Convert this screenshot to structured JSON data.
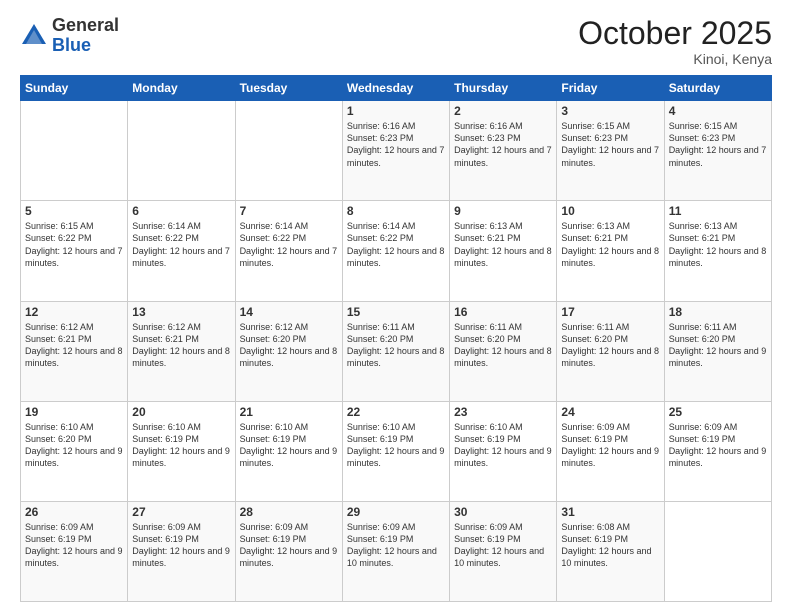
{
  "header": {
    "logo_general": "General",
    "logo_blue": "Blue",
    "month_title": "October 2025",
    "location": "Kinoi, Kenya"
  },
  "days_of_week": [
    "Sunday",
    "Monday",
    "Tuesday",
    "Wednesday",
    "Thursday",
    "Friday",
    "Saturday"
  ],
  "weeks": [
    [
      {
        "day": "",
        "sunrise": "",
        "sunset": "",
        "daylight": ""
      },
      {
        "day": "",
        "sunrise": "",
        "sunset": "",
        "daylight": ""
      },
      {
        "day": "",
        "sunrise": "",
        "sunset": "",
        "daylight": ""
      },
      {
        "day": "1",
        "sunrise": "Sunrise: 6:16 AM",
        "sunset": "Sunset: 6:23 PM",
        "daylight": "Daylight: 12 hours and 7 minutes."
      },
      {
        "day": "2",
        "sunrise": "Sunrise: 6:16 AM",
        "sunset": "Sunset: 6:23 PM",
        "daylight": "Daylight: 12 hours and 7 minutes."
      },
      {
        "day": "3",
        "sunrise": "Sunrise: 6:15 AM",
        "sunset": "Sunset: 6:23 PM",
        "daylight": "Daylight: 12 hours and 7 minutes."
      },
      {
        "day": "4",
        "sunrise": "Sunrise: 6:15 AM",
        "sunset": "Sunset: 6:23 PM",
        "daylight": "Daylight: 12 hours and 7 minutes."
      }
    ],
    [
      {
        "day": "5",
        "sunrise": "Sunrise: 6:15 AM",
        "sunset": "Sunset: 6:22 PM",
        "daylight": "Daylight: 12 hours and 7 minutes."
      },
      {
        "day": "6",
        "sunrise": "Sunrise: 6:14 AM",
        "sunset": "Sunset: 6:22 PM",
        "daylight": "Daylight: 12 hours and 7 minutes."
      },
      {
        "day": "7",
        "sunrise": "Sunrise: 6:14 AM",
        "sunset": "Sunset: 6:22 PM",
        "daylight": "Daylight: 12 hours and 7 minutes."
      },
      {
        "day": "8",
        "sunrise": "Sunrise: 6:14 AM",
        "sunset": "Sunset: 6:22 PM",
        "daylight": "Daylight: 12 hours and 8 minutes."
      },
      {
        "day": "9",
        "sunrise": "Sunrise: 6:13 AM",
        "sunset": "Sunset: 6:21 PM",
        "daylight": "Daylight: 12 hours and 8 minutes."
      },
      {
        "day": "10",
        "sunrise": "Sunrise: 6:13 AM",
        "sunset": "Sunset: 6:21 PM",
        "daylight": "Daylight: 12 hours and 8 minutes."
      },
      {
        "day": "11",
        "sunrise": "Sunrise: 6:13 AM",
        "sunset": "Sunset: 6:21 PM",
        "daylight": "Daylight: 12 hours and 8 minutes."
      }
    ],
    [
      {
        "day": "12",
        "sunrise": "Sunrise: 6:12 AM",
        "sunset": "Sunset: 6:21 PM",
        "daylight": "Daylight: 12 hours and 8 minutes."
      },
      {
        "day": "13",
        "sunrise": "Sunrise: 6:12 AM",
        "sunset": "Sunset: 6:21 PM",
        "daylight": "Daylight: 12 hours and 8 minutes."
      },
      {
        "day": "14",
        "sunrise": "Sunrise: 6:12 AM",
        "sunset": "Sunset: 6:20 PM",
        "daylight": "Daylight: 12 hours and 8 minutes."
      },
      {
        "day": "15",
        "sunrise": "Sunrise: 6:11 AM",
        "sunset": "Sunset: 6:20 PM",
        "daylight": "Daylight: 12 hours and 8 minutes."
      },
      {
        "day": "16",
        "sunrise": "Sunrise: 6:11 AM",
        "sunset": "Sunset: 6:20 PM",
        "daylight": "Daylight: 12 hours and 8 minutes."
      },
      {
        "day": "17",
        "sunrise": "Sunrise: 6:11 AM",
        "sunset": "Sunset: 6:20 PM",
        "daylight": "Daylight: 12 hours and 8 minutes."
      },
      {
        "day": "18",
        "sunrise": "Sunrise: 6:11 AM",
        "sunset": "Sunset: 6:20 PM",
        "daylight": "Daylight: 12 hours and 9 minutes."
      }
    ],
    [
      {
        "day": "19",
        "sunrise": "Sunrise: 6:10 AM",
        "sunset": "Sunset: 6:20 PM",
        "daylight": "Daylight: 12 hours and 9 minutes."
      },
      {
        "day": "20",
        "sunrise": "Sunrise: 6:10 AM",
        "sunset": "Sunset: 6:19 PM",
        "daylight": "Daylight: 12 hours and 9 minutes."
      },
      {
        "day": "21",
        "sunrise": "Sunrise: 6:10 AM",
        "sunset": "Sunset: 6:19 PM",
        "daylight": "Daylight: 12 hours and 9 minutes."
      },
      {
        "day": "22",
        "sunrise": "Sunrise: 6:10 AM",
        "sunset": "Sunset: 6:19 PM",
        "daylight": "Daylight: 12 hours and 9 minutes."
      },
      {
        "day": "23",
        "sunrise": "Sunrise: 6:10 AM",
        "sunset": "Sunset: 6:19 PM",
        "daylight": "Daylight: 12 hours and 9 minutes."
      },
      {
        "day": "24",
        "sunrise": "Sunrise: 6:09 AM",
        "sunset": "Sunset: 6:19 PM",
        "daylight": "Daylight: 12 hours and 9 minutes."
      },
      {
        "day": "25",
        "sunrise": "Sunrise: 6:09 AM",
        "sunset": "Sunset: 6:19 PM",
        "daylight": "Daylight: 12 hours and 9 minutes."
      }
    ],
    [
      {
        "day": "26",
        "sunrise": "Sunrise: 6:09 AM",
        "sunset": "Sunset: 6:19 PM",
        "daylight": "Daylight: 12 hours and 9 minutes."
      },
      {
        "day": "27",
        "sunrise": "Sunrise: 6:09 AM",
        "sunset": "Sunset: 6:19 PM",
        "daylight": "Daylight: 12 hours and 9 minutes."
      },
      {
        "day": "28",
        "sunrise": "Sunrise: 6:09 AM",
        "sunset": "Sunset: 6:19 PM",
        "daylight": "Daylight: 12 hours and 9 minutes."
      },
      {
        "day": "29",
        "sunrise": "Sunrise: 6:09 AM",
        "sunset": "Sunset: 6:19 PM",
        "daylight": "Daylight: 12 hours and 10 minutes."
      },
      {
        "day": "30",
        "sunrise": "Sunrise: 6:09 AM",
        "sunset": "Sunset: 6:19 PM",
        "daylight": "Daylight: 12 hours and 10 minutes."
      },
      {
        "day": "31",
        "sunrise": "Sunrise: 6:08 AM",
        "sunset": "Sunset: 6:19 PM",
        "daylight": "Daylight: 12 hours and 10 minutes."
      },
      {
        "day": "",
        "sunrise": "",
        "sunset": "",
        "daylight": ""
      }
    ]
  ]
}
